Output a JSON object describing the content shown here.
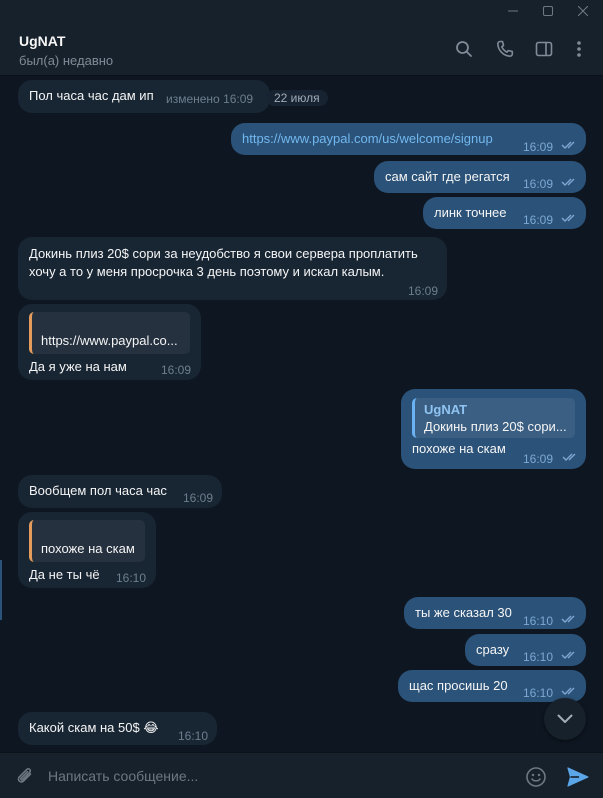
{
  "window": {
    "minimize": "—",
    "maximize": "☐",
    "close": "✕"
  },
  "header": {
    "name": "UgNAT",
    "status": "был(а) недавно"
  },
  "date_pill": "22 июля",
  "messages": {
    "m1": {
      "text": "Пол часа час дам ип",
      "time": "изменено 16:09"
    },
    "m2": {
      "text": "https://www.paypal.com/us/welcome/signup",
      "time": "16:09"
    },
    "m3": {
      "text": "сам сайт где регатся",
      "time": "16:09"
    },
    "m4": {
      "text": "линк точнее",
      "time": "16:09"
    },
    "m5": {
      "line1": "Докинь плиз 20$ сори за неудобство я свои сервера проплатить",
      "line2": "хочу а то у меня просрочка 3 день поэтому и искал калым.",
      "time": "16:09"
    },
    "m6": {
      "reply": "https://www.paypal.co...",
      "text": "Да я уже на нам",
      "time": "16:09"
    },
    "m7": {
      "reply_name": "UgNAT",
      "reply_text": "Докинь плиз 20$ сори...",
      "text": "похоже на скам",
      "time": "16:09"
    },
    "m8": {
      "text": "Вообщем пол часа час",
      "time": "16:09"
    },
    "m9": {
      "reply": "похоже на скам",
      "text": "Да не ты чё",
      "time": "16:10"
    },
    "m10": {
      "text": "ты же сказал 30",
      "time": "16:10"
    },
    "m11": {
      "text": "сразу",
      "time": "16:10"
    },
    "m12": {
      "text": "щас просишь 20",
      "time": "16:10"
    },
    "m13": {
      "text": "Какой скам на 50$",
      "emoji": "😂",
      "time": "16:10"
    }
  },
  "composer": {
    "placeholder": "Написать сообщение..."
  },
  "icons": [
    "search-icon",
    "phone-icon",
    "sidebar-icon",
    "more-icon",
    "attach-icon",
    "emoji-icon",
    "send-icon",
    "chevron-down-icon",
    "double-check-icon"
  ],
  "colors": {
    "background": "#0e1621",
    "incoming": "#182533",
    "outgoing": "#2b5278",
    "accent": "#6ab2f2",
    "reply_bar": "#e39c5b"
  }
}
